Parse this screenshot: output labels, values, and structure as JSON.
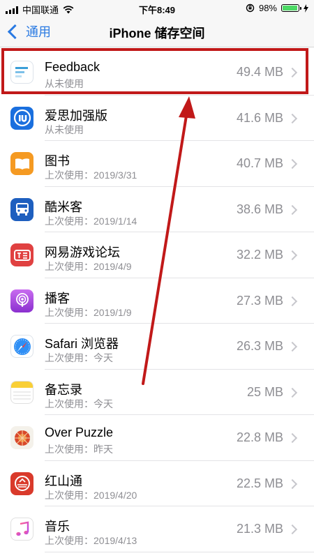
{
  "status_bar": {
    "carrier": "中国联通",
    "time": "下午8:49",
    "battery_percent": "98%",
    "battery_level": 0.98
  },
  "nav": {
    "back_label": "通用",
    "title": "iPhone 储存空间"
  },
  "apps": [
    {
      "name": "Feedback",
      "sub": "从未使用",
      "size": "49.4 MB",
      "icon": "feedback-icon"
    },
    {
      "name": "爱思加强版",
      "sub": "从未使用",
      "size": "41.6 MB",
      "icon": "i4-icon"
    },
    {
      "name": "图书",
      "sub": "上次使用：2019/3/31",
      "size": "40.7 MB",
      "icon": "books-icon"
    },
    {
      "name": "酷米客",
      "sub": "上次使用：2019/1/14",
      "size": "38.6 MB",
      "icon": "bus-icon"
    },
    {
      "name": "网易游戏论坛",
      "sub": "上次使用：2019/4/9",
      "size": "32.2 MB",
      "icon": "forum-icon"
    },
    {
      "name": "播客",
      "sub": "上次使用：2019/1/9",
      "size": "27.3 MB",
      "icon": "podcasts-icon"
    },
    {
      "name": "Safari 浏览器",
      "sub": "上次使用：今天",
      "size": "26.3 MB",
      "icon": "safari-icon"
    },
    {
      "name": "备忘录",
      "sub": "上次使用：今天",
      "size": "25 MB",
      "icon": "notes-icon"
    },
    {
      "name": "Over Puzzle",
      "sub": "上次使用：昨天",
      "size": "22.8 MB",
      "icon": "puzzle-icon"
    },
    {
      "name": "红山通",
      "sub": "上次使用：2019/4/20",
      "size": "22.5 MB",
      "icon": "hongshantong-icon"
    },
    {
      "name": "音乐",
      "sub": "上次使用：2019/4/13",
      "size": "21.3 MB",
      "icon": "music-icon"
    }
  ],
  "annotation": {
    "highlight_color": "#c11919"
  }
}
